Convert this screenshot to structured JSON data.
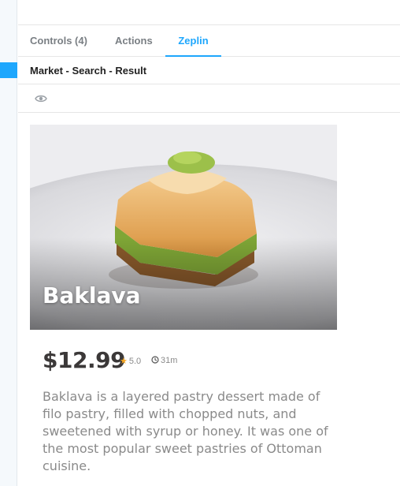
{
  "tabs": {
    "controls": "Controls (4)",
    "actions": "Actions",
    "zeplin": "Zeplin"
  },
  "story": {
    "title": "Market - Search - Result"
  },
  "toolbar": {
    "icons": [
      "eye-icon"
    ]
  },
  "product": {
    "name": "Baklava",
    "price": "$12.99",
    "rating": "5.0",
    "time": "31m",
    "description": "Baklava is a layered pastry dessert made of filo pastry, filled with chopped nuts, and sweetened with syrup or honey. It was one of the most popular sweet pastries of Ottoman cuisine."
  },
  "colors": {
    "accent": "#1ea7fd",
    "star": "#f5a623",
    "price": "#3b3838",
    "muted_text": "#8a8a8a"
  }
}
